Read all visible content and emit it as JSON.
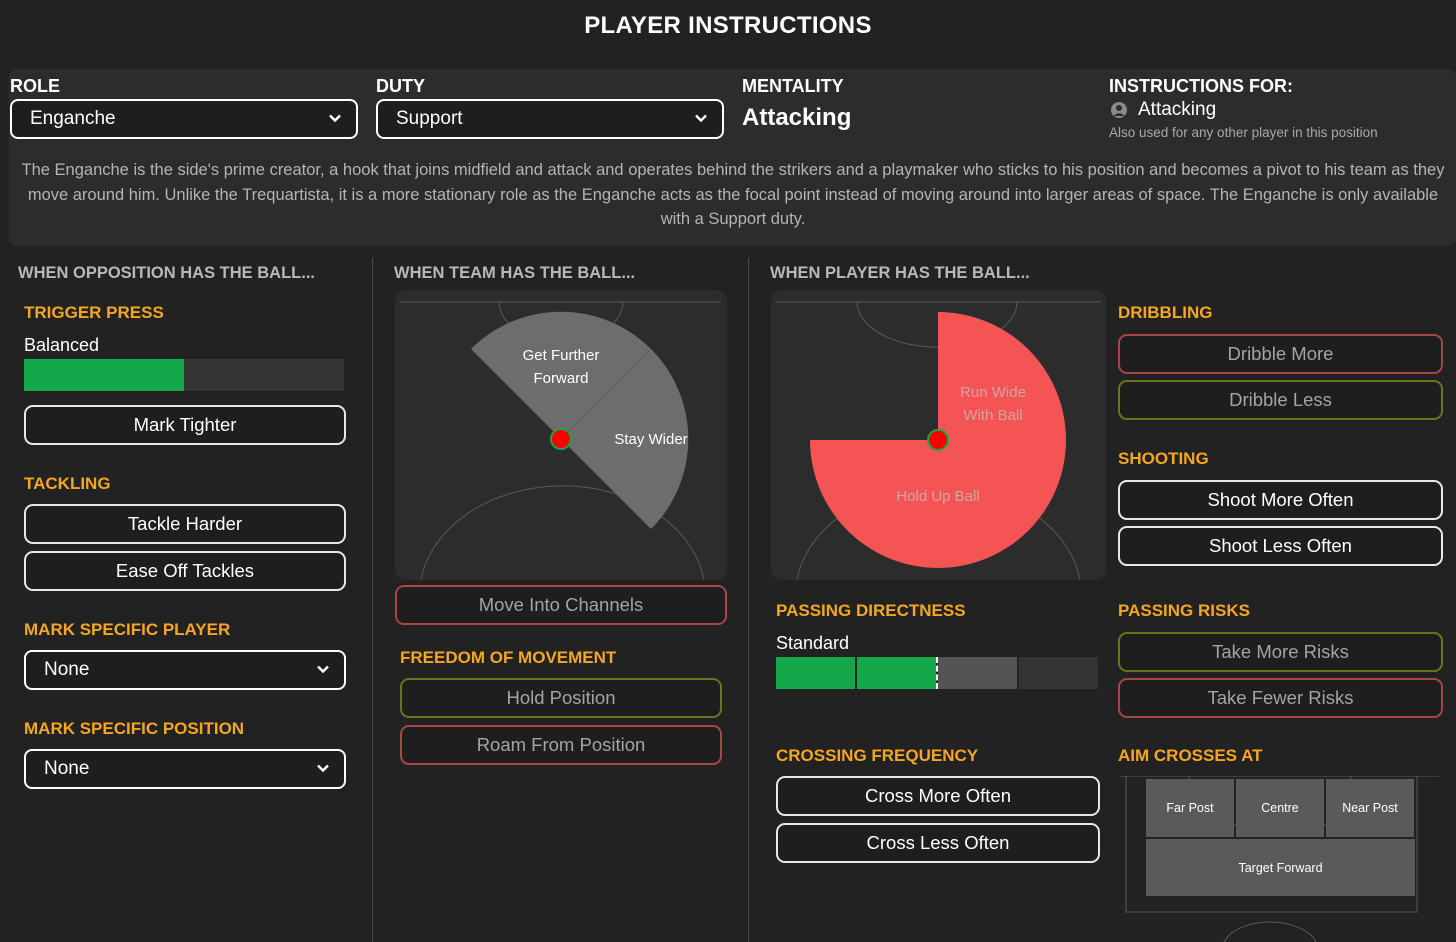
{
  "page_title": "PLAYER INSTRUCTIONS",
  "header": {
    "role_label": "ROLE",
    "role_value": "Enganche",
    "duty_label": "DUTY",
    "duty_value": "Support",
    "mentality_label": "MENTALITY",
    "mentality_value": "Attacking",
    "instructions_for_label": "INSTRUCTIONS FOR:",
    "instructions_for_value": "Attacking",
    "instructions_for_note": "Also used for any other player in this position",
    "description": "The Enganche is the side's prime creator, a hook that joins midfield and attack and operates behind the strikers and a playmaker who sticks to his position and becomes a pivot to his team as they move around him. Unlike the Trequartista, it is a more stationary role as the Enganche acts as the focal point instead of moving around into larger areas of space. The Enganche is only available with a Support duty."
  },
  "opposition": {
    "heading": "WHEN OPPOSITION HAS THE BALL...",
    "trigger_press": {
      "title": "TRIGGER PRESS",
      "value": "Balanced",
      "level": 0.5
    },
    "mark_tighter": "Mark Tighter",
    "tackling": {
      "title": "TACKLING",
      "harder": "Tackle Harder",
      "ease_off": "Ease Off Tackles"
    },
    "mark_player": {
      "title": "MARK SPECIFIC PLAYER",
      "value": "None"
    },
    "mark_position": {
      "title": "MARK SPECIFIC POSITION",
      "value": "None"
    }
  },
  "team": {
    "heading": "WHEN TEAM HAS THE BALL...",
    "pitch": {
      "label_forward_1": "Get Further",
      "label_forward_2": "Forward",
      "label_wider": "Stay Wider"
    },
    "channels": "Move Into Channels",
    "freedom": {
      "title": "FREEDOM OF MOVEMENT",
      "hold": "Hold Position",
      "roam": "Roam From Position"
    }
  },
  "player": {
    "heading": "WHEN PLAYER HAS THE BALL...",
    "pitch": {
      "label_wide_1": "Run Wide",
      "label_wide_2": "With Ball",
      "label_hold": "Hold Up Ball"
    },
    "passing_directness": {
      "title": "PASSING DIRECTNESS",
      "value": "Standard",
      "level": 0.5
    },
    "crossing": {
      "title": "CROSSING FREQUENCY",
      "more": "Cross More Often",
      "less": "Cross Less Often"
    },
    "dribbling": {
      "title": "DRIBBLING",
      "more": "Dribble More",
      "less": "Dribble Less"
    },
    "shooting": {
      "title": "SHOOTING",
      "more": "Shoot More Often",
      "less": "Shoot Less Often"
    },
    "passing_risks": {
      "title": "PASSING RISKS",
      "more": "Take More Risks",
      "fewer": "Take Fewer Risks"
    },
    "aim_crosses": {
      "title": "AIM CROSSES AT",
      "far_post": "Far Post",
      "centre": "Centre",
      "near_post": "Near Post",
      "target_forward": "Target Forward"
    }
  },
  "colors": {
    "accent_orange": "#f5a623",
    "bar_green": "#14a84a",
    "btn_red_border": "#a84646",
    "btn_olive_border": "#67751c",
    "pitch_red": "#f55454",
    "marker_red": "#ff0000"
  }
}
